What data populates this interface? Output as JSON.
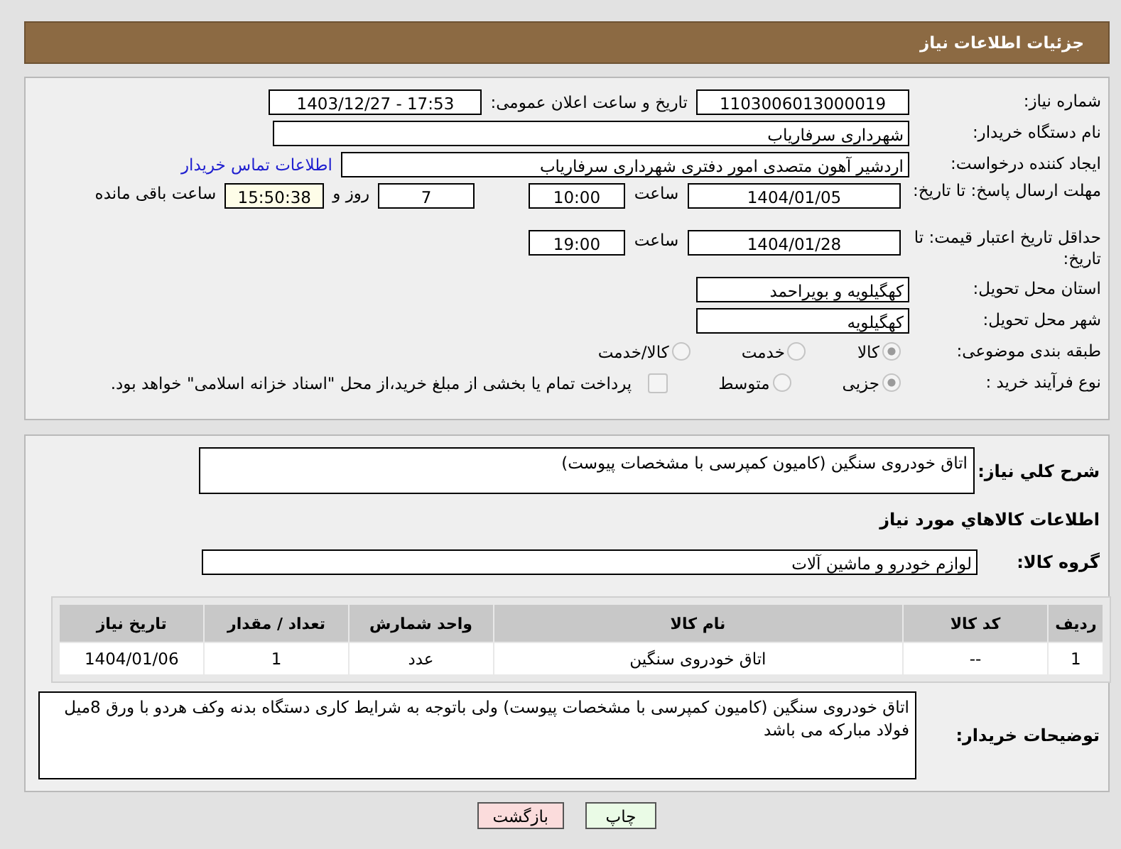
{
  "header": {
    "title": "جزئیات اطلاعات نیاز"
  },
  "need_number": {
    "label": "شماره نیاز:",
    "value": "1103006013000019"
  },
  "announce": {
    "label": "تاریخ و ساعت اعلان عمومی:",
    "value": "1403/12/27 - 17:53"
  },
  "buyer_org": {
    "label": "نام دستگاه خریدار:",
    "value": "شهرداری سرفاریاب"
  },
  "requester": {
    "label": "ایجاد کننده درخواست:",
    "value": "اردشیر آهون متصدی امور دفتری شهرداری سرفاریاب",
    "link": "اطلاعات تماس خریدار"
  },
  "reply_deadline": {
    "label": "مهلت ارسال پاسخ: تا تاریخ:",
    "date": "1404/01/05",
    "time_label": "ساعت",
    "time": "10:00",
    "days": "7",
    "days_label": "روز و",
    "remaining": "15:50:38",
    "remaining_label": "ساعت باقی مانده"
  },
  "price_validity": {
    "label": "حداقل تاریخ اعتبار قیمت: تا تاریخ:",
    "date": "1404/01/28",
    "time_label": "ساعت",
    "time": "19:00"
  },
  "province": {
    "label": "استان محل تحویل:",
    "value": "کهگیلویه و بویراحمد"
  },
  "city": {
    "label": "شهر محل تحویل:",
    "value": "کهگیلویه"
  },
  "category": {
    "label": "طبقه بندی موضوعی:",
    "options": [
      {
        "label": "کالا",
        "selected": true
      },
      {
        "label": "خدمت",
        "selected": false
      },
      {
        "label": "کالا/خدمت",
        "selected": false
      }
    ]
  },
  "process": {
    "label": "نوع فرآیند خرید :",
    "options": [
      {
        "label": "جزیی",
        "selected": true
      },
      {
        "label": "متوسط",
        "selected": false
      }
    ],
    "payment": {
      "label": "پرداخت تمام یا بخشی از مبلغ خرید،از محل \"اسناد خزانه اسلامی\" خواهد بود.",
      "checked": false
    }
  },
  "description": {
    "label": "شرح کلي نياز:",
    "value": "اتاق خودروی  سنگین (کامیون کمپرسی با مشخصات پیوست)"
  },
  "goods_title": "اطلاعات کالاهاي مورد نياز",
  "goods_group": {
    "label": "گروه کالا:",
    "value": "لوازم خودرو و ماشین آلات"
  },
  "table": {
    "columns": [
      "ردیف",
      "کد کالا",
      "نام کالا",
      "واحد شمارش",
      "تعداد / مقدار",
      "تاریخ نیاز"
    ],
    "rows": [
      [
        "1",
        "--",
        "اتاق خودروی سنگین",
        "عدد",
        "1",
        "1404/01/06"
      ]
    ]
  },
  "buyer_notes": {
    "label": "توضیحات خریدار:",
    "value": "اتاق خودروی  سنگین (کامیون کمپرسی با مشخصات پیوست)  ولی باتوجه به شرایط کاری دستگاه بدنه وکف هردو با ورق 8میل فولاد مبارکه می باشد"
  },
  "buttons": [
    {
      "label": "چاپ",
      "kind": "print"
    },
    {
      "label": "بازگشت",
      "kind": "back"
    }
  ]
}
